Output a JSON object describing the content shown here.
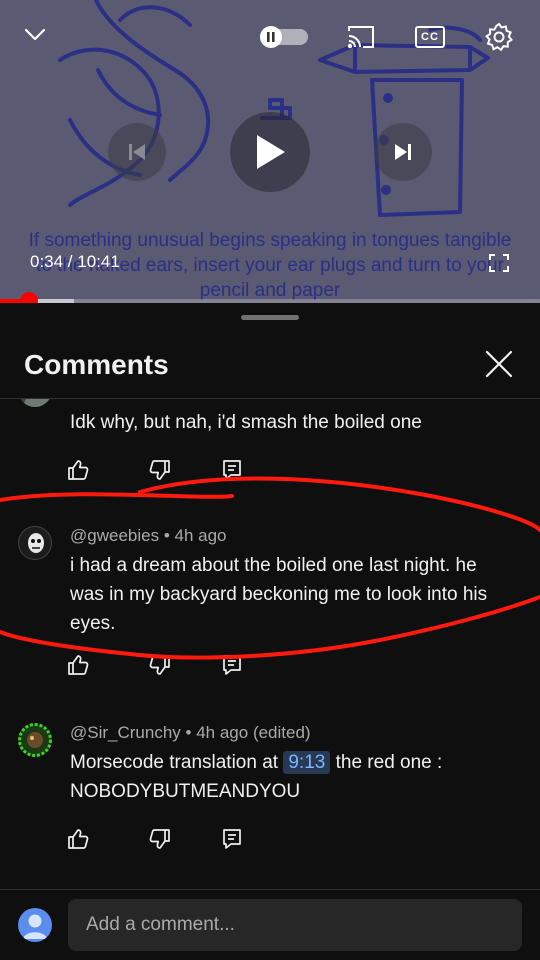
{
  "player": {
    "caption_text": "If something unusual begins speaking in tongues tangible to the naked ears, insert your ear plugs and turn to your pencil and paper",
    "current_time": "0:34",
    "duration": "10:41",
    "time_display": "0:34 / 10:41",
    "progress_fraction": 0.053,
    "buffered_fraction": 0.137,
    "state": "playing",
    "icons": {
      "collapse": "chevron-down-icon",
      "autoplay": "autoplay-toggle-icon",
      "cast": "cast-icon",
      "captions": "cc-icon",
      "settings": "gear-icon",
      "previous": "skip-previous-icon",
      "play": "play-icon",
      "next": "skip-next-icon",
      "fullscreen": "fullscreen-icon"
    },
    "cc_label": "CC"
  },
  "comments_panel": {
    "title": "Comments",
    "items": [
      {
        "author": "",
        "time": "",
        "body": "Idk why, but nah, i'd smash the boiled one"
      },
      {
        "author": "@gweebies",
        "time": "4h ago",
        "body": "i had a dream about the boiled one last night. he was in my backyard beckoning me to look into his eyes."
      },
      {
        "author": "@Sir_Crunchy",
        "time": "4h ago (edited)",
        "body_prefix": "Morsecode translation at",
        "timestamp_link": "9:13",
        "body_suffix": "the red one :",
        "body_line2": "NOBODYBUTMEANDYOU"
      }
    ],
    "action_icons": [
      "like-icon",
      "dislike-icon",
      "reply-icon"
    ]
  },
  "composer": {
    "placeholder": "Add a comment..."
  },
  "colors": {
    "background": "#0f0f0f",
    "text_primary": "#f1f1f1",
    "text_secondary": "#aaaaaa",
    "accent_red": "#ff0000",
    "link_blue": "#7fb4ff",
    "annotation_red": "#ff1a0d",
    "video_tint": "#5a5a72",
    "drawing_ink": "#2b2f86"
  }
}
